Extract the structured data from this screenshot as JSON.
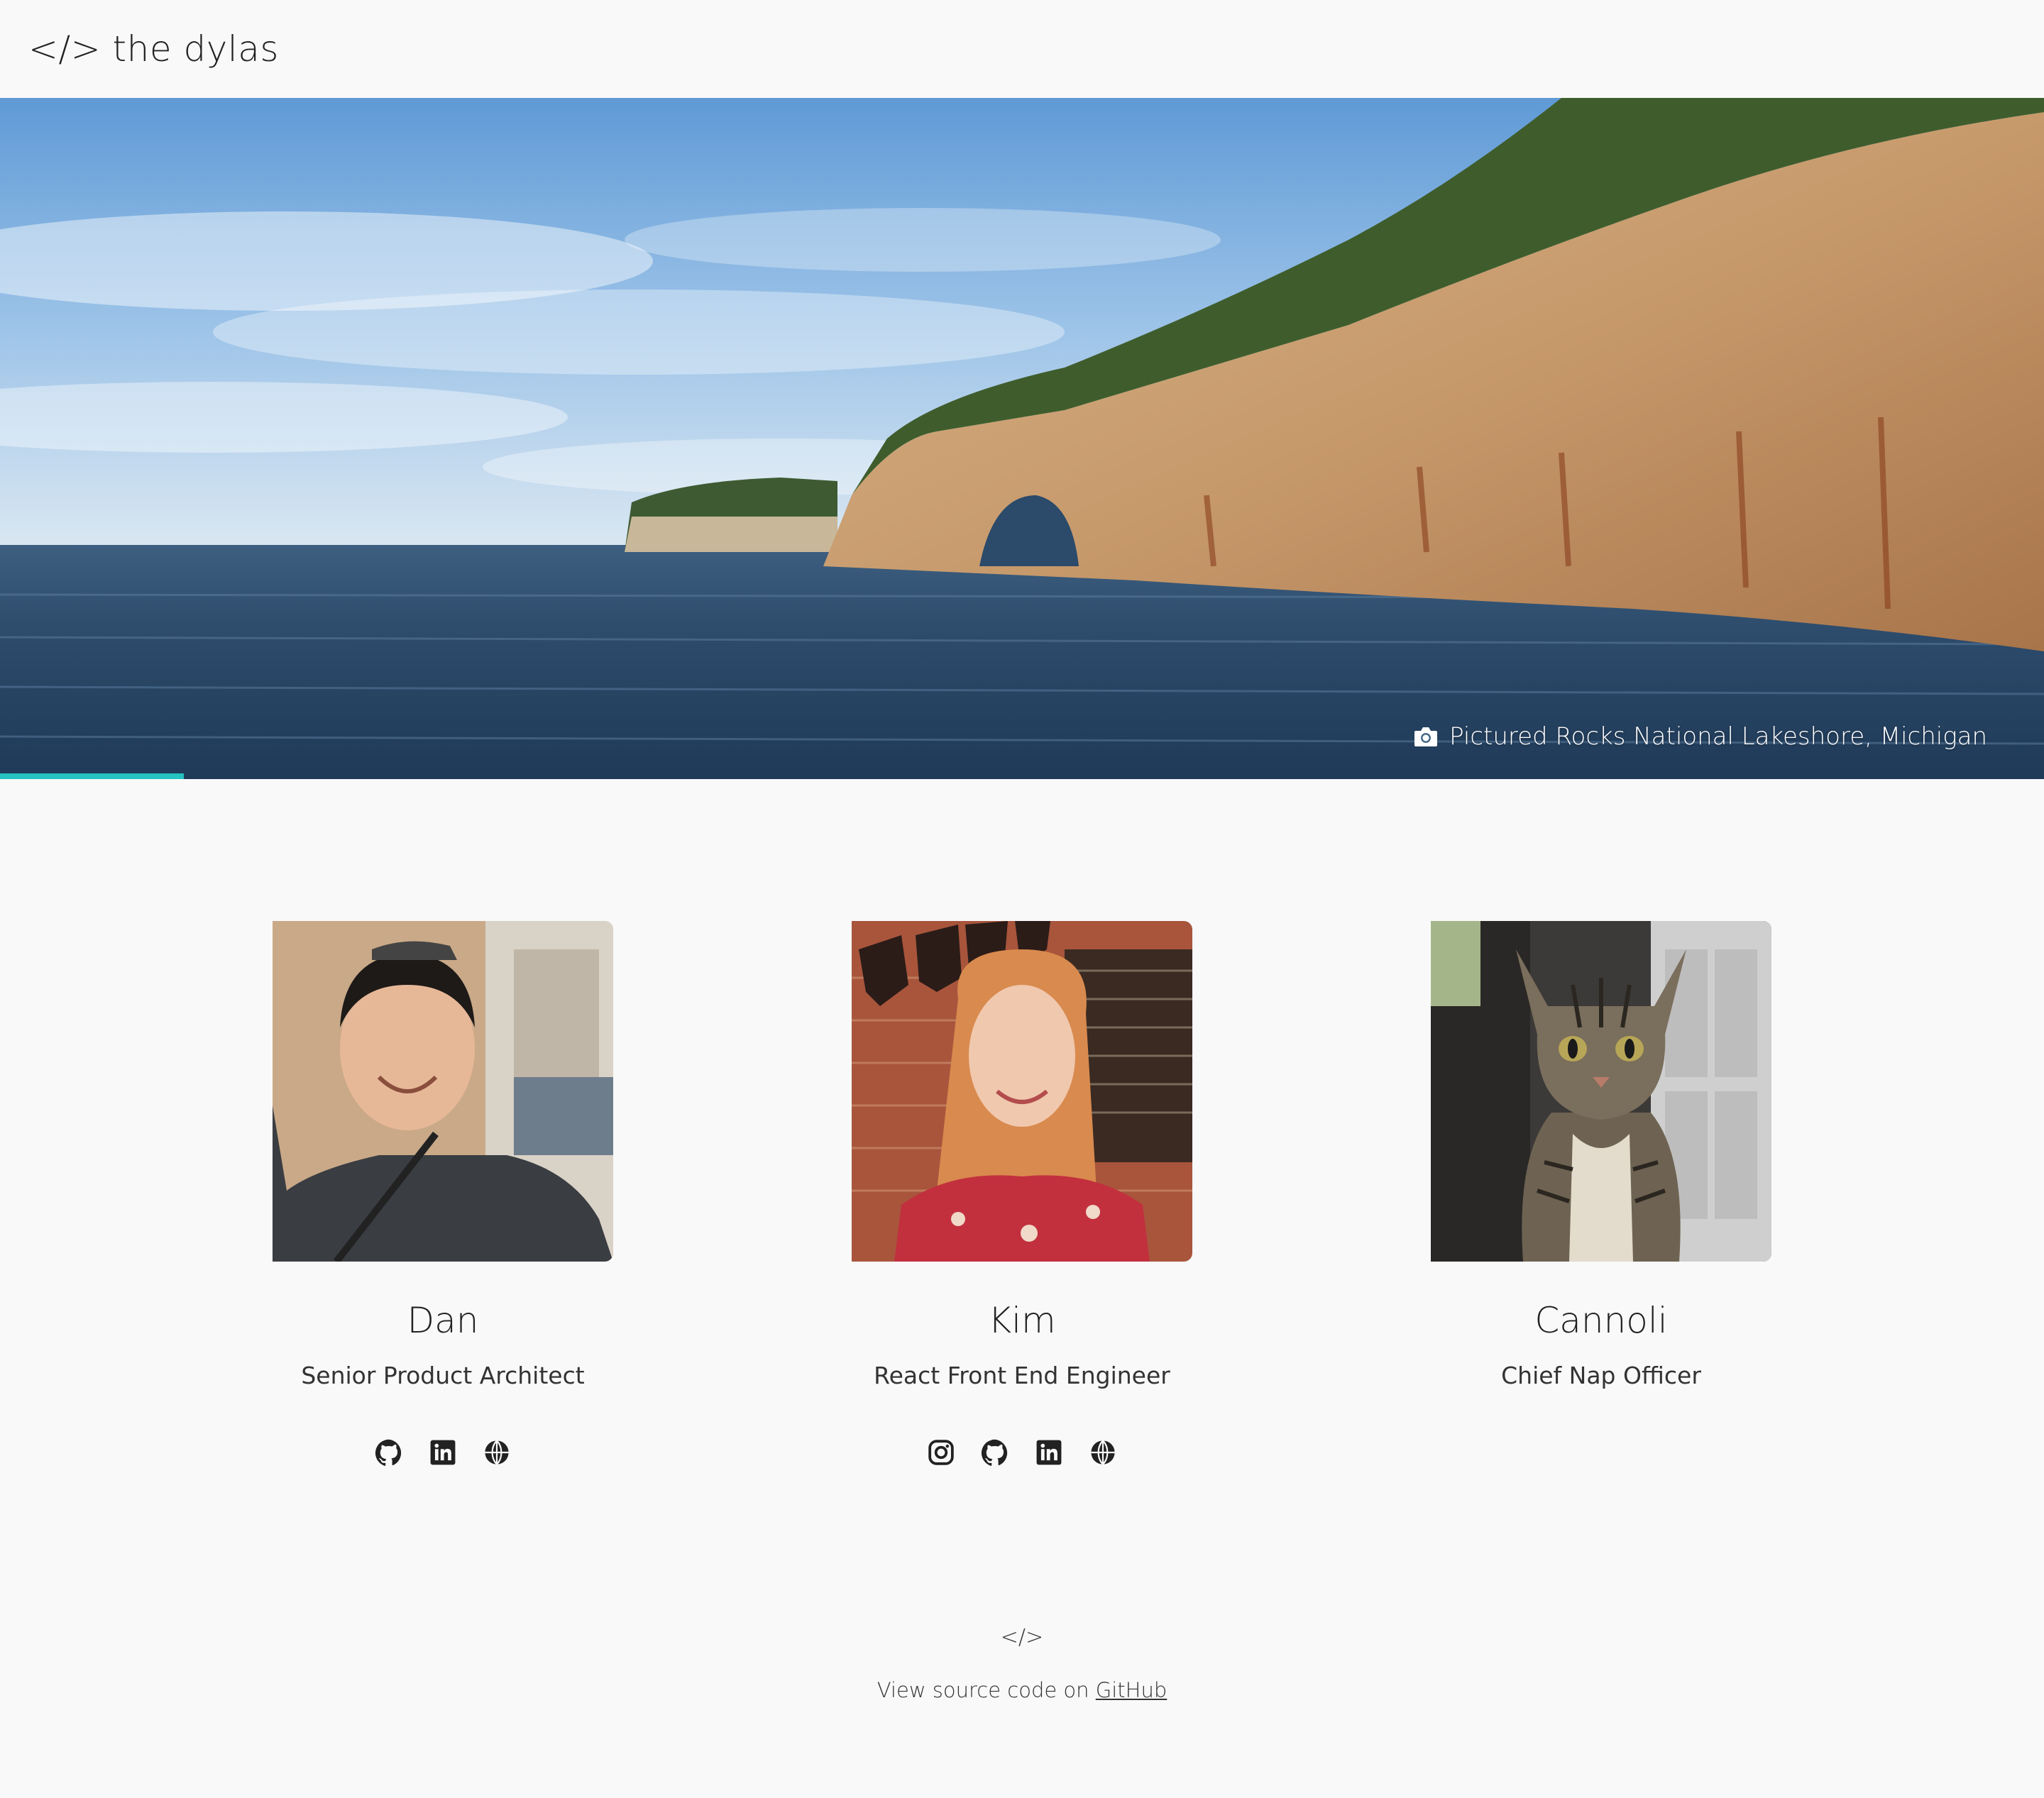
{
  "header": {
    "logo": "</> the dylas"
  },
  "hero": {
    "caption": "Pictured Rocks National Lakeshore, Michigan",
    "caption_icon": "camera-icon",
    "progress_fraction": 0.09,
    "accent_color": "#24c2c0"
  },
  "team": [
    {
      "name": "Dan",
      "role": "Senior Product Architect",
      "socials": [
        "github-icon",
        "linkedin-icon",
        "globe-icon"
      ]
    },
    {
      "name": "Kim",
      "role": "React Front End Engineer",
      "socials": [
        "instagram-icon",
        "github-icon",
        "linkedin-icon",
        "globe-icon"
      ]
    },
    {
      "name": "Cannoli",
      "role": "Chief Nap Officer",
      "socials": []
    }
  ],
  "footer": {
    "mark": "</>",
    "text_prefix": "View source code on ",
    "link_label": "GitHub"
  }
}
